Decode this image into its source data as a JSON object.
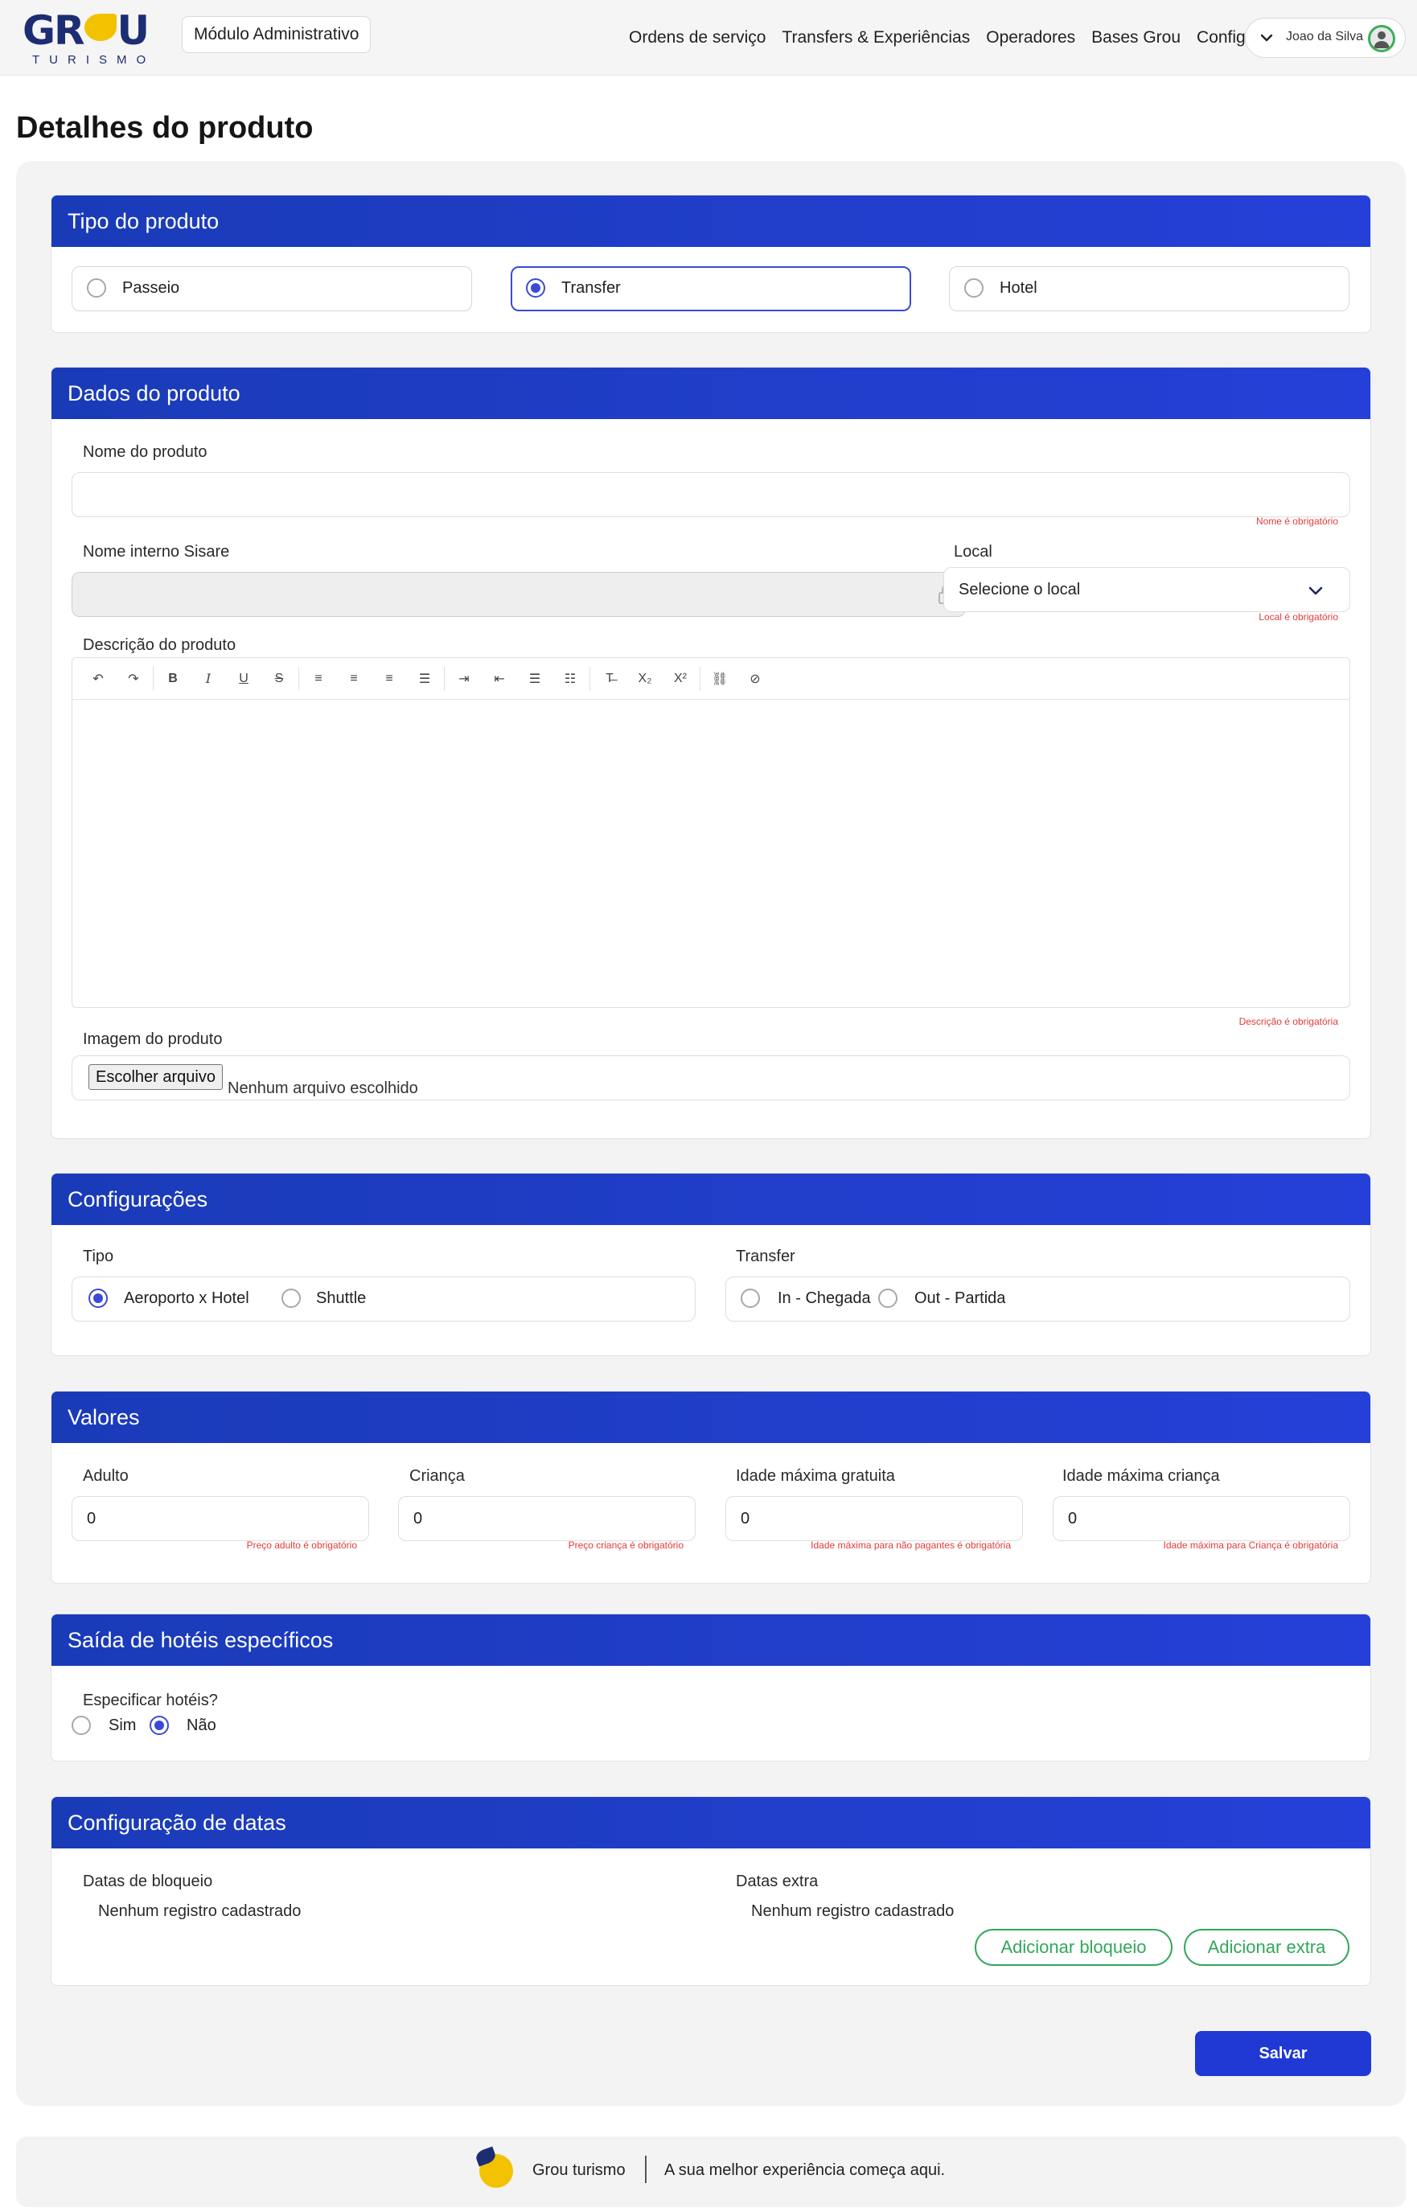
{
  "header": {
    "logo_text_a": "GR",
    "logo_text_b": "U",
    "logo_sub": "TURISMO",
    "module": "Módulo Administrativo",
    "nav": [
      "Ordens de serviço",
      "Transfers & Experiências",
      "Operadores",
      "Bases Grou",
      "Configuração"
    ],
    "user": "Joao da Silva"
  },
  "page_title": "Detalhes do produto",
  "tipo": {
    "title": "Tipo do produto",
    "options": [
      {
        "label": "Passeio",
        "selected": false
      },
      {
        "label": "Transfer",
        "selected": true
      },
      {
        "label": "Hotel",
        "selected": false
      }
    ]
  },
  "dados": {
    "title": "Dados do produto",
    "nome_label": "Nome do produto",
    "nome_value": "",
    "nome_error": "Nome é obrigatório",
    "sisare_label": "Nome interno Sisare",
    "sisare_value": "",
    "local_label": "Local",
    "local_value": "Selecione o local",
    "local_error": "Local é obrigatório",
    "descricao_label": "Descrição do produto",
    "descricao_error": "Descrição é obrigatória",
    "imagem_label": "Imagem do produto",
    "file_button": "Escolher arquivo",
    "file_status": "Nenhum arquivo escolhido"
  },
  "config": {
    "title": "Configurações",
    "tipo_label": "Tipo",
    "tipo_options": [
      {
        "label": "Aeroporto x Hotel",
        "selected": true
      },
      {
        "label": "Shuttle",
        "selected": false
      }
    ],
    "transfer_label": "Transfer",
    "transfer_options": [
      {
        "label": "In - Chegada",
        "selected": false
      },
      {
        "label": "Out - Partida",
        "selected": false
      }
    ]
  },
  "valores": {
    "title": "Valores",
    "fields": [
      {
        "label": "Adulto",
        "value": "0",
        "error": "Preço adulto é obrigatório"
      },
      {
        "label": "Criança",
        "value": "0",
        "error": "Preço criança é obrigatório"
      },
      {
        "label": "Idade máxima gratuita",
        "value": "0",
        "error": "Idade máxima para não pagantes é obrigatória"
      },
      {
        "label": "Idade máxima criança",
        "value": "0",
        "error": "Idade máxima para Criança é obrigatória"
      }
    ]
  },
  "saida": {
    "title": "Saída de hotéis específicos",
    "question": "Especificar hotéis?",
    "options": [
      {
        "label": "Sim",
        "selected": false
      },
      {
        "label": "Não",
        "selected": true
      }
    ]
  },
  "datas": {
    "title": "Configuração de datas",
    "bloqueio_label": "Datas de bloqueio",
    "bloqueio_empty": "Nenhum registro cadastrado",
    "extra_label": "Datas extra",
    "extra_empty": "Nenhum registro cadastrado",
    "add_bloqueio": "Adicionar bloqueio",
    "add_extra": "Adicionar extra"
  },
  "save_label": "Salvar",
  "footer": {
    "name": "Grou turismo",
    "tagline": "A sua melhor experiência começa aqui."
  },
  "colors": {
    "primary": "#2038d4",
    "section_header": "#1a3bb8",
    "success": "#31a85a",
    "error": "#e23b3b"
  }
}
